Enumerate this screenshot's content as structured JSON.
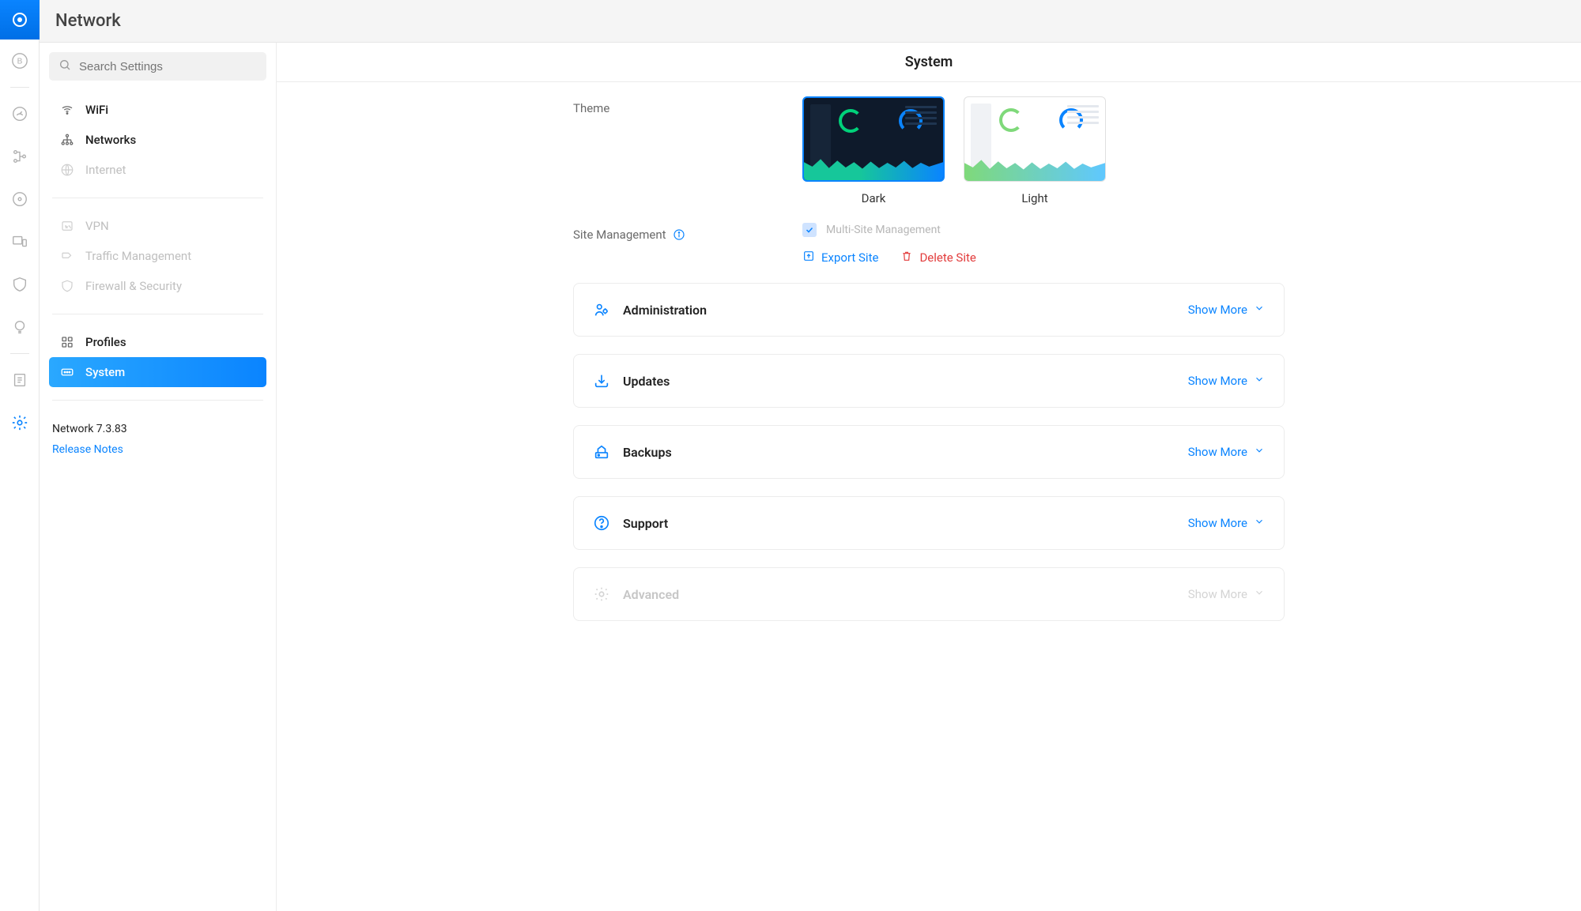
{
  "header": {
    "title": "Network"
  },
  "main_title": "System",
  "search": {
    "placeholder": "Search Settings"
  },
  "sidebar": {
    "items": [
      {
        "label": "WiFi"
      },
      {
        "label": "Networks"
      },
      {
        "label": "Internet"
      },
      {
        "label": "VPN"
      },
      {
        "label": "Traffic Management"
      },
      {
        "label": "Firewall & Security"
      },
      {
        "label": "Profiles"
      },
      {
        "label": "System"
      }
    ],
    "version": "Network 7.3.83",
    "release_notes_label": "Release Notes"
  },
  "theme": {
    "label": "Theme",
    "options": {
      "dark": "Dark",
      "light": "Light"
    },
    "selected": "dark"
  },
  "site_management": {
    "label": "Site Management",
    "checkbox_label": "Multi-Site Management",
    "export_label": "Export Site",
    "delete_label": "Delete Site"
  },
  "sections": {
    "administration": {
      "label": "Administration",
      "action": "Show More"
    },
    "updates": {
      "label": "Updates",
      "action": "Show More"
    },
    "backups": {
      "label": "Backups",
      "action": "Show More"
    },
    "support": {
      "label": "Support",
      "action": "Show More"
    },
    "advanced": {
      "label": "Advanced",
      "action": "Show More"
    }
  }
}
